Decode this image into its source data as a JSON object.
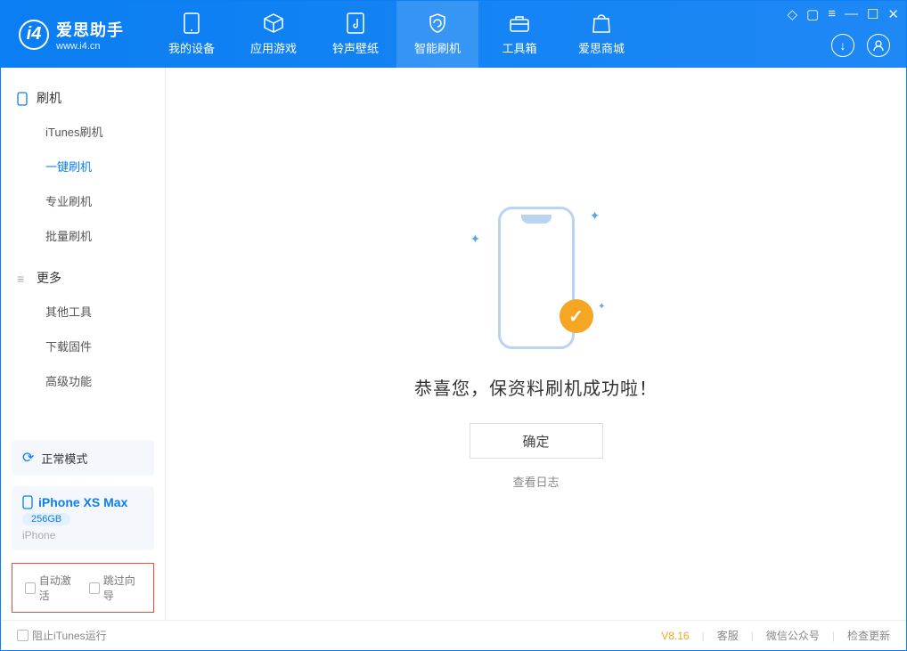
{
  "logo": {
    "title": "爱思助手",
    "subtitle": "www.i4.cn"
  },
  "tabs": [
    {
      "label": "我的设备"
    },
    {
      "label": "应用游戏"
    },
    {
      "label": "铃声壁纸"
    },
    {
      "label": "智能刷机"
    },
    {
      "label": "工具箱"
    },
    {
      "label": "爱思商城"
    }
  ],
  "sidebar": {
    "group1": {
      "title": "刷机",
      "items": [
        "iTunes刷机",
        "一键刷机",
        "专业刷机",
        "批量刷机"
      ]
    },
    "group2": {
      "title": "更多",
      "items": [
        "其他工具",
        "下载固件",
        "高级功能"
      ]
    }
  },
  "mode": {
    "label": "正常模式"
  },
  "device": {
    "name": "iPhone XS Max",
    "capacity": "256GB",
    "type": "iPhone"
  },
  "options": {
    "auto_activate": "自动激活",
    "skip_guide": "跳过向导"
  },
  "main": {
    "success_text": "恭喜您，保资料刷机成功啦！",
    "ok_button": "确定",
    "log_link": "查看日志"
  },
  "footer": {
    "block_itunes": "阻止iTunes运行",
    "version": "V8.16",
    "links": [
      "客服",
      "微信公众号",
      "检查更新"
    ]
  }
}
